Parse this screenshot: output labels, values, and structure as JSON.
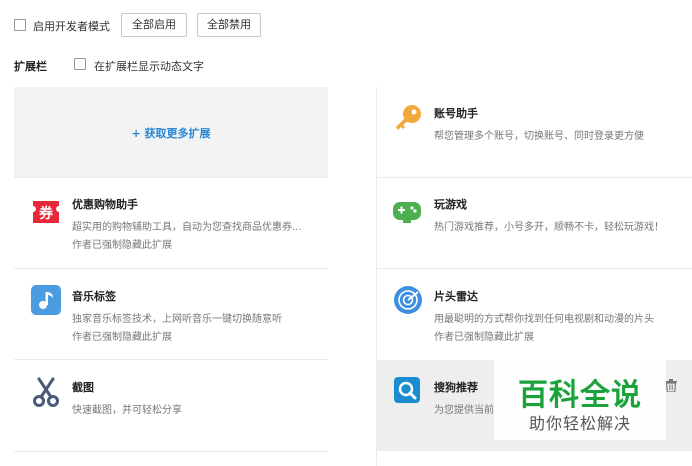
{
  "toolbar": {
    "dev_mode_label": "启用开发者模式",
    "enable_all_label": "全部启用",
    "disable_all_label": "全部禁用"
  },
  "extbar": {
    "title": "扩展栏",
    "show_dynamic_label": "在扩展栏显示动态文字"
  },
  "get_more": {
    "label": "+ 获取更多扩展"
  },
  "extensions": [
    {
      "title": "优惠购物助手",
      "desc": "超实用的购物辅助工具，自动为您查找商品优惠券...",
      "note": "作者已强制隐藏此扩展",
      "icon": "coupon-icon"
    },
    {
      "title": "账号助手",
      "desc": "帮您管理多个账号，切换账号、同时登录更方便",
      "note": "",
      "icon": "key-icon"
    },
    {
      "title": "音乐标签",
      "desc": "独家音乐标签技术，上网听音乐一键切换随意听",
      "note": "作者已强制隐藏此扩展",
      "icon": "music-note-icon"
    },
    {
      "title": "玩游戏",
      "desc": "热门游戏推荐，小号多开，顺畅不卡，轻松玩游戏！",
      "note": "",
      "icon": "gamepad-icon"
    },
    {
      "title": "截图",
      "desc": "快速截图，并可轻松分享",
      "note": "",
      "icon": "scissors-icon"
    },
    {
      "title": "片头雷达",
      "desc": "用最聪明的方式帮你找到任何电视剧和动漫的片头",
      "note": "作者已强制隐藏此扩展",
      "icon": "radar-icon"
    },
    {
      "title": "搜狗推荐",
      "desc": "为您提供当前",
      "note": "",
      "icon": "search-recommend-icon"
    }
  ],
  "watermark": {
    "main": "百科全说",
    "sub": "助你轻松解决"
  },
  "colors": {
    "link_blue": "#2a87d8",
    "watermark_green": "#1aa33b"
  }
}
